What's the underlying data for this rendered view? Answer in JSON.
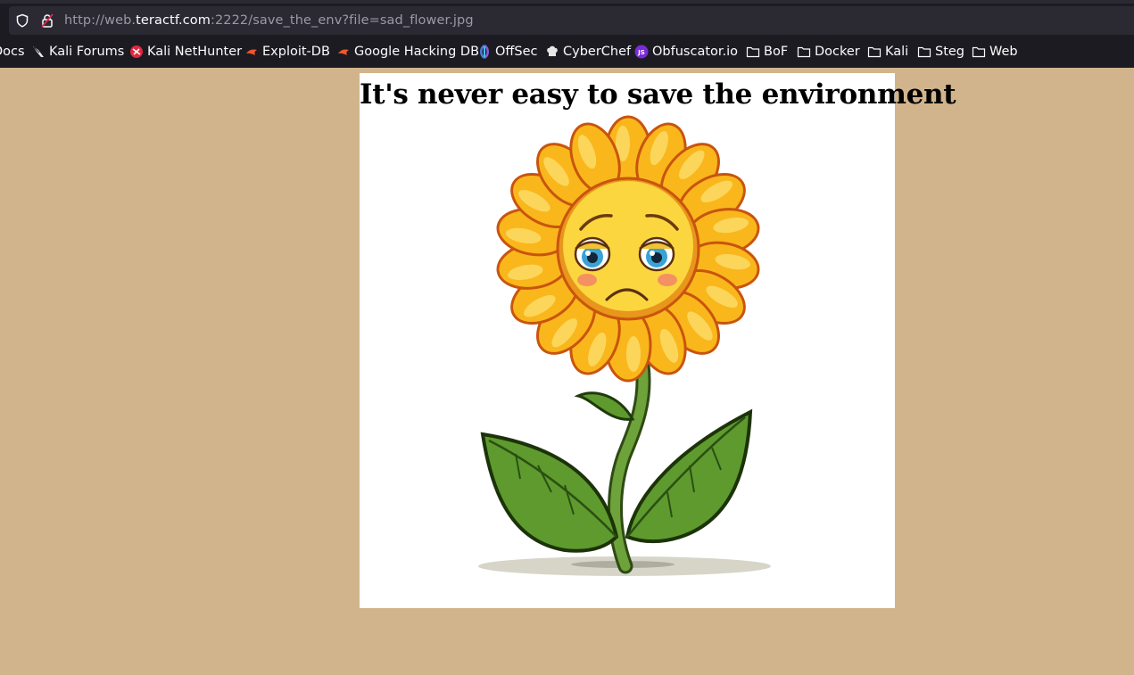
{
  "browser": {
    "url_prefix": "http://web.",
    "url_host": "teractf.com",
    "url_suffix": ":2222/save_the_env?file=sad_flower.jpg"
  },
  "bookmarks": [
    {
      "label": "Docs",
      "icon": "kali-icon"
    },
    {
      "label": "Kali Forums",
      "icon": "kali-dragon-icon"
    },
    {
      "label": "Kali NetHunter",
      "icon": "nethunter-icon"
    },
    {
      "label": "Exploit-DB",
      "icon": "exploit-db-icon"
    },
    {
      "label": "Google Hacking DB",
      "icon": "exploit-db-icon"
    },
    {
      "label": "OffSec",
      "icon": "offsec-icon"
    },
    {
      "label": "CyberChef",
      "icon": "chef-hat-icon"
    },
    {
      "label": "Obfuscator.io",
      "icon": "js-icon"
    },
    {
      "label": "BoF",
      "icon": "folder-icon"
    },
    {
      "label": "Docker",
      "icon": "folder-icon"
    },
    {
      "label": "Kali",
      "icon": "folder-icon"
    },
    {
      "label": "Steg",
      "icon": "folder-icon"
    },
    {
      "label": "Web",
      "icon": "folder-icon"
    }
  ],
  "page": {
    "title": "It's never easy to save the environment",
    "image_subject": "sad sunflower cartoon"
  },
  "colors": {
    "page_background": "#d2b48c",
    "petal": "#f9b71c",
    "leaf": "#5e9a2e"
  }
}
